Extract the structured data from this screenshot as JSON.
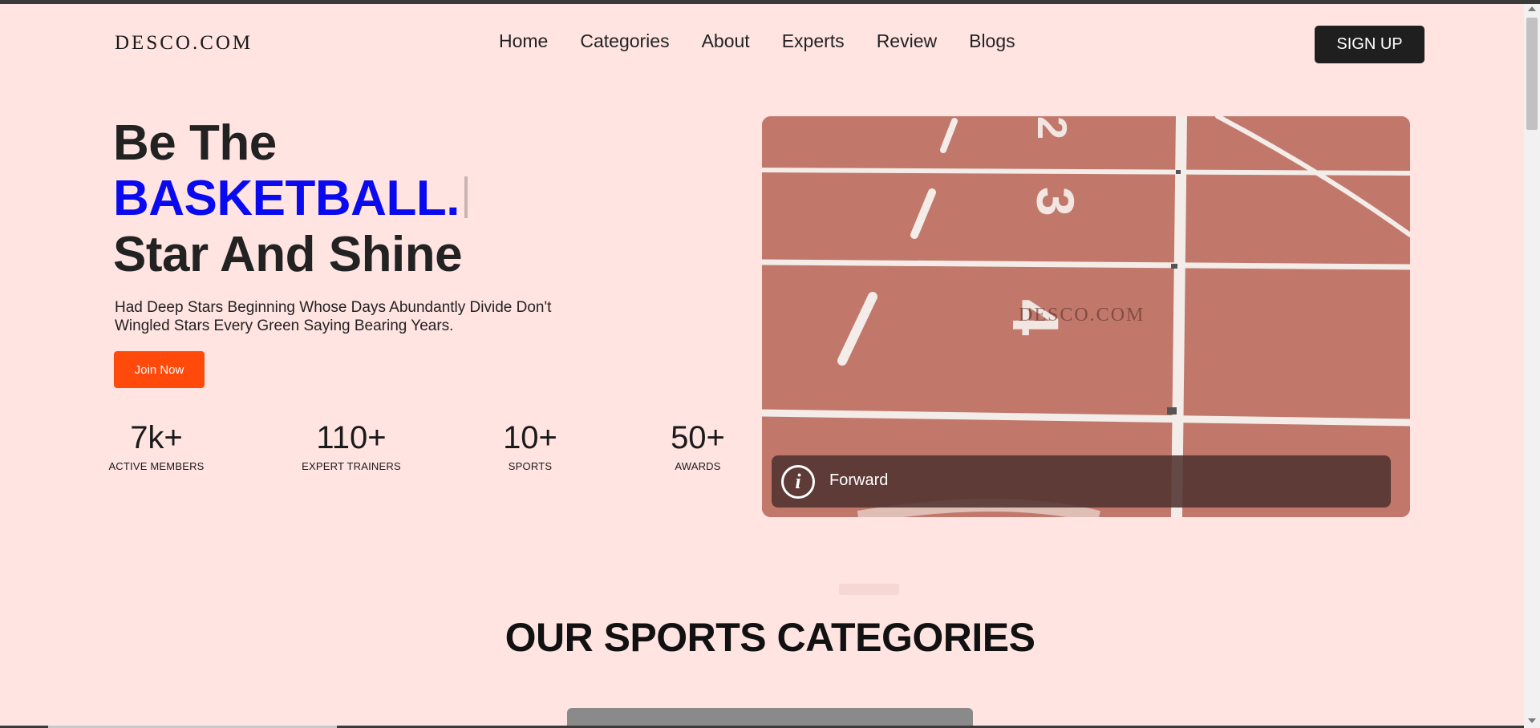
{
  "header": {
    "logo": "DESCO.COM",
    "nav": [
      "Home",
      "Categories",
      "About",
      "Experts",
      "Review",
      "Blogs"
    ],
    "signup_label": "SIGN UP"
  },
  "hero": {
    "line1": "Be The",
    "line2": "BASKETBALL.",
    "line3": "Star And Shine",
    "description": "Had Deep Stars Beginning Whose Days Abundantly Divide Don't Wingled Stars Every Green Saying Bearing Years.",
    "join_label": "Join Now",
    "stats": [
      {
        "value": "7k+",
        "label": "ACTIVE MEMBERS"
      },
      {
        "value": "110+",
        "label": "EXPERT TRAINERS"
      },
      {
        "value": "10+",
        "label": "SPORTS"
      },
      {
        "value": "50+",
        "label": "AWARDS"
      }
    ],
    "image": {
      "watermark": "DESCO.COM",
      "caption": "Forward",
      "lane_numbers": [
        "2",
        "3",
        "4"
      ]
    }
  },
  "sections": {
    "categories_title": "OUR SPORTS CATEGORIES"
  },
  "colors": {
    "background": "#ffe4e1",
    "accent_blue": "#0a0af0",
    "join_button": "#ff4a0b",
    "signup_button": "#1f1f1f",
    "track": "#c57c6f"
  }
}
